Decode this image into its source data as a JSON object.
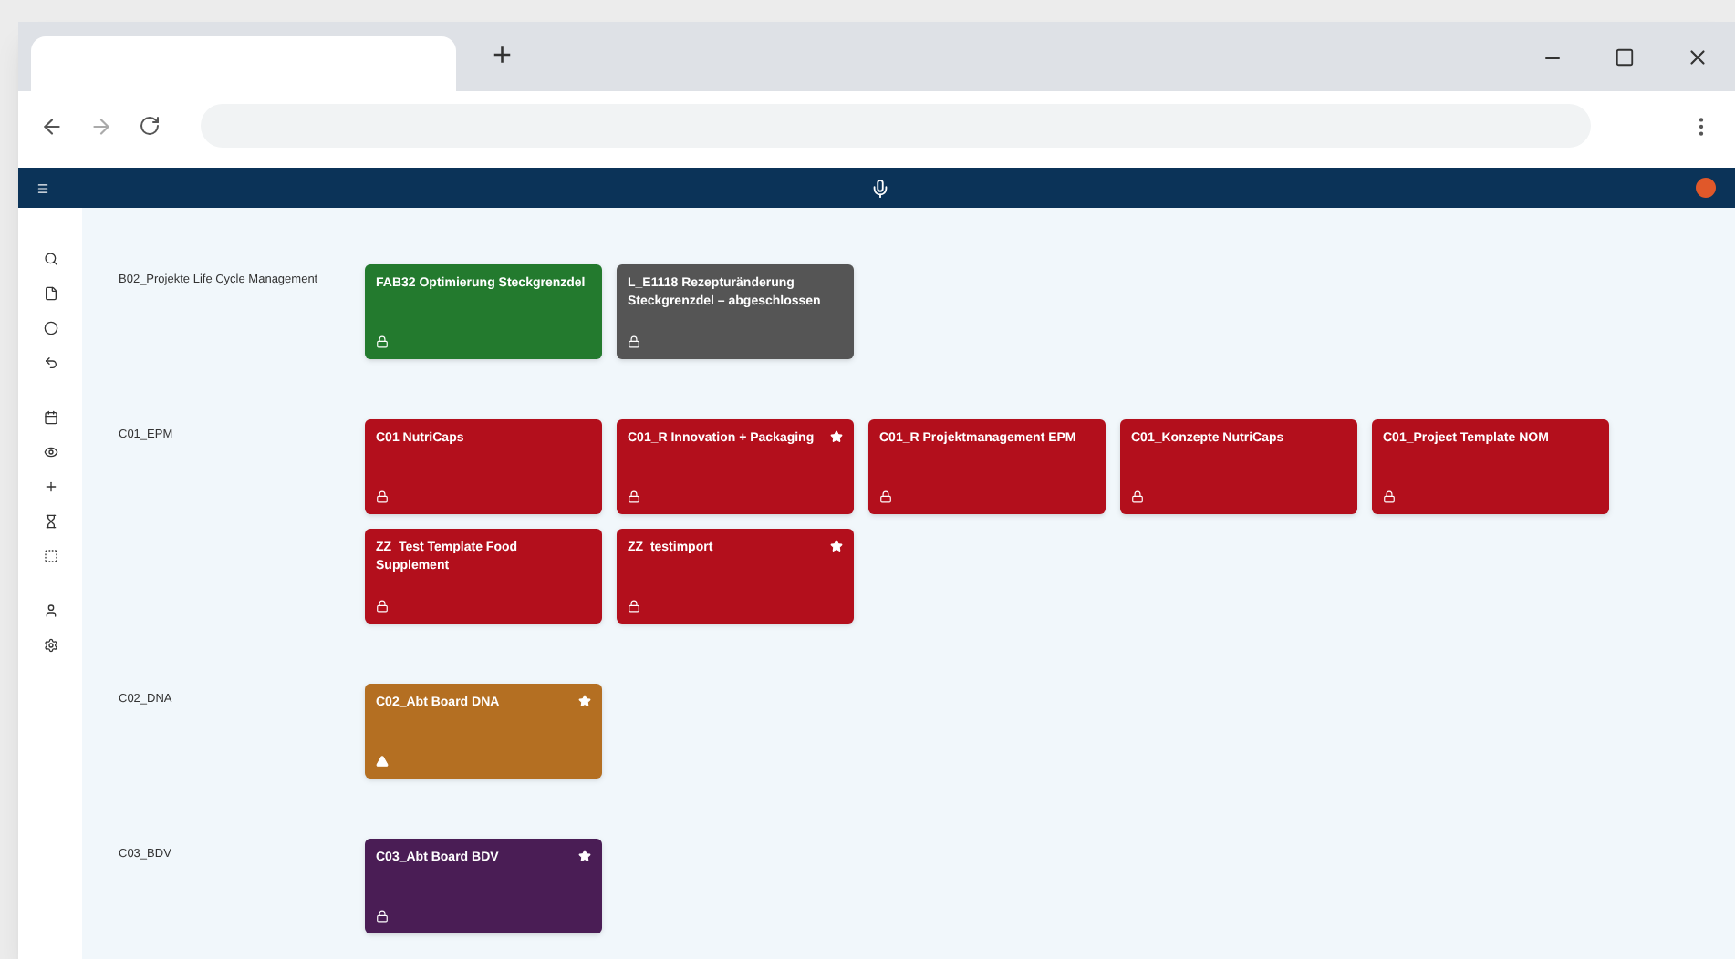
{
  "browser": {
    "new_tab": "+"
  },
  "groups": [
    {
      "label": "B02_Projekte Life Cycle Management",
      "cards": [
        {
          "title": "FAB32 Optimierung Steckgrenzdel",
          "color": "#237a2e",
          "favorite": false,
          "alert": false
        },
        {
          "title": "L_E1118 Rezepturänderung Steckgrenzdel – abgeschlossen",
          "color": "#555555",
          "favorite": false,
          "alert": false
        }
      ]
    },
    {
      "label": "C01_EPM",
      "cards": [
        {
          "title": "C01 NutriCaps",
          "color": "#b30f1c",
          "favorite": false,
          "alert": false
        },
        {
          "title": "C01_R Innovation + Packaging",
          "color": "#b30f1c",
          "favorite": true,
          "alert": false
        },
        {
          "title": "C01_R Projektmanagement EPM",
          "color": "#b30f1c",
          "favorite": false,
          "alert": false
        },
        {
          "title": "C01_Konzepte NutriCaps",
          "color": "#b30f1c",
          "favorite": false,
          "alert": false
        },
        {
          "title": "C01_Project Template NOM",
          "color": "#b30f1c",
          "favorite": false,
          "alert": false
        },
        {
          "title": "ZZ_Test Template Food Supplement",
          "color": "#b30f1c",
          "favorite": false,
          "alert": false
        },
        {
          "title": "ZZ_testimport",
          "color": "#b30f1c",
          "favorite": true,
          "alert": false
        }
      ]
    },
    {
      "label": "C02_DNA",
      "cards": [
        {
          "title": "C02_Abt Board DNA",
          "color": "#b46f22",
          "favorite": true,
          "alert": true
        }
      ]
    },
    {
      "label": "C03_BDV",
      "cards": [
        {
          "title": "C03_Abt Board BDV",
          "color": "#4a1d55",
          "favorite": true,
          "alert": false
        }
      ]
    }
  ]
}
